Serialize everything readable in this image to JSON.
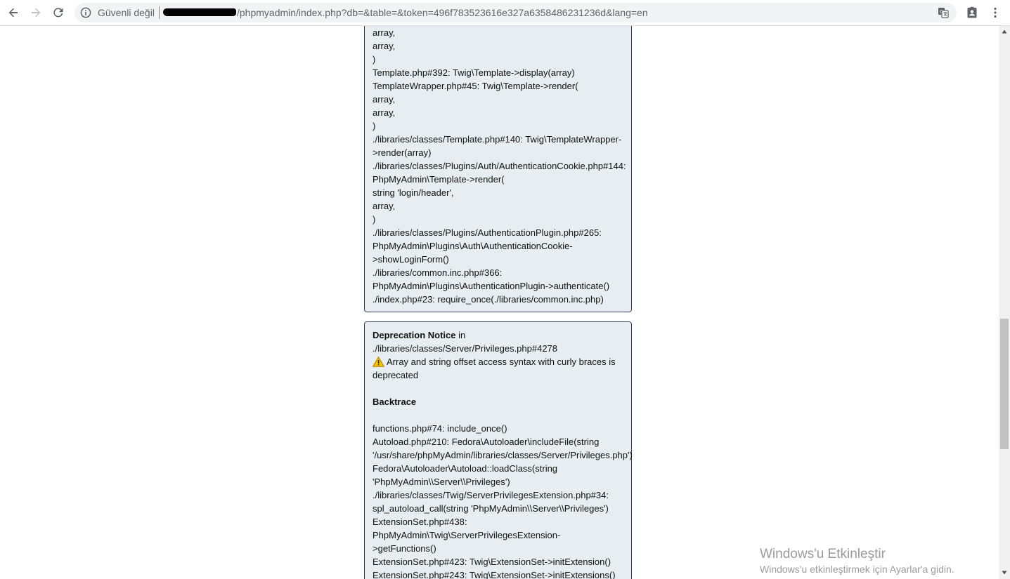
{
  "browser": {
    "security_label": "Güvenli değil",
    "url_path": "/phpmyadmin/index.php?db=&table=&token=496f783523616e327a6358486231236d&lang=en",
    "icons": {
      "back": "arrow-left-icon",
      "forward": "arrow-right-icon",
      "reload": "reload-icon",
      "info": "info-icon",
      "translate": "translate-icon",
      "account": "account-badge-icon",
      "menu": "kebab-menu-icon"
    }
  },
  "first_notice": {
    "trace_lines": [
      "array,",
      "array,",
      ")",
      "Template.php#392: Twig\\Template->display(array)",
      "TemplateWrapper.php#45: Twig\\Template->render(",
      "array,",
      "array,",
      ")",
      "./libraries/classes/Template.php#140: Twig\\TemplateWrapper-",
      ">render(array)",
      "./libraries/classes/Plugins/Auth/AuthenticationCookie.php#144:",
      "PhpMyAdmin\\Template->render(",
      "string 'login/header',",
      "array,",
      ")",
      "./libraries/classes/Plugins/AuthenticationPlugin.php#265:",
      "PhpMyAdmin\\Plugins\\Auth\\AuthenticationCookie-",
      ">showLoginForm()",
      "./libraries/common.inc.php#366:",
      "PhpMyAdmin\\Plugins\\AuthenticationPlugin->authenticate()",
      "./index.php#23: require_once(./libraries/common.inc.php)"
    ]
  },
  "second_notice": {
    "title": "Deprecation Notice",
    "title_suffix": " in",
    "file": "./libraries/classes/Server/Privileges.php#4278",
    "message_line1": "Array and string offset access syntax with curly braces is",
    "message_line2": "deprecated",
    "backtrace_heading": "Backtrace",
    "trace_lines": [
      "functions.php#74: include_once()",
      "Autoload.php#210: Fedora\\Autoloader\\includeFile(string",
      "'/usr/share/phpMyAdmin/libraries/classes/Server/Privileges.php')",
      "Fedora\\Autoloader\\Autoload::loadClass(string",
      "'PhpMyAdmin\\\\Server\\\\Privileges')",
      "./libraries/classes/Twig/ServerPrivilegesExtension.php#34:",
      "spl_autoload_call(string 'PhpMyAdmin\\\\Server\\\\Privileges')",
      "ExtensionSet.php#438:",
      "PhpMyAdmin\\Twig\\ServerPrivilegesExtension-",
      ">getFunctions()",
      "ExtensionSet.php#423: Twig\\ExtensionSet->initExtension()",
      "ExtensionSet.php#243: Twig\\ExtensionSet->initExtensions()"
    ]
  },
  "watermark": {
    "title": "Windows'u Etkinleştir",
    "subtitle": "Windows'u etkinleştirmek için Ayarlar'a gidin."
  },
  "colors": {
    "notice_bg": "#e7edf1",
    "notice_border": "#2e4057",
    "warning_yellow": "#f5c400"
  }
}
